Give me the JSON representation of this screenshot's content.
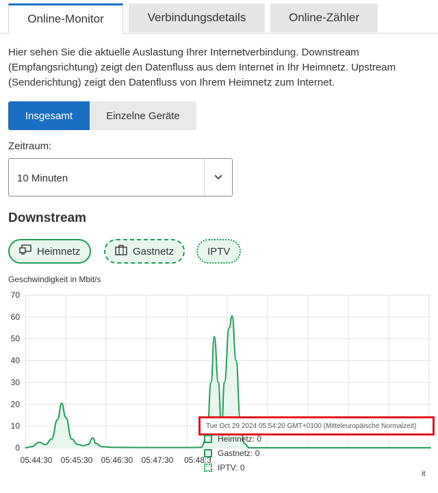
{
  "tabs": [
    {
      "label": "Online-Monitor",
      "active": true
    },
    {
      "label": "Verbindungsdetails",
      "active": false
    },
    {
      "label": "Online-Zähler",
      "active": false
    }
  ],
  "intro": "Hier sehen Sie die aktuelle Auslastung Ihrer Internetverbindung. Downstream (Empfangsrichtung) zeigt den Datenfluss aus dem Internet in Ihr Heimnetz. Upstream (Senderichtung) zeigt den Datenfluss von Ihrem Heimnetz zum Internet.",
  "segments": {
    "total": "Insgesamt",
    "devices": "Einzelne Geräte"
  },
  "period": {
    "label": "Zeitraum:",
    "value": "10 Minuten"
  },
  "section_title": "Downstream",
  "chips": [
    {
      "label": "Heimnetz",
      "icon": "monitor-icon"
    },
    {
      "label": "Gastnetz",
      "icon": "suitcase-icon"
    },
    {
      "label": "IPTV",
      "icon": ""
    }
  ],
  "colors": {
    "accent": "#1b6fc2",
    "series": "#1f9d55",
    "fill": "#e8f6ee",
    "highlight": "#e3141e"
  },
  "chart_data": {
    "type": "area",
    "ylabel": "Geschwindigkeit in Mbit/s",
    "ylim": [
      0,
      70
    ],
    "yticks": [
      0,
      10,
      20,
      30,
      40,
      50,
      60,
      70
    ],
    "xticks": [
      "05:44:30",
      "05:45:30",
      "05:46:30",
      "05:47:30",
      "05:48:3"
    ],
    "grid": true,
    "series": [
      {
        "name": "Heimnetz",
        "points": [
          [
            0,
            0
          ],
          [
            0.15,
            0.5
          ],
          [
            0.35,
            2.5
          ],
          [
            0.5,
            1.5
          ],
          [
            0.65,
            4
          ],
          [
            0.8,
            13
          ],
          [
            0.9,
            20.5
          ],
          [
            1.0,
            14
          ],
          [
            1.15,
            4
          ],
          [
            1.3,
            1.5
          ],
          [
            1.45,
            1
          ],
          [
            1.55,
            1.5
          ],
          [
            1.67,
            4.5
          ],
          [
            1.75,
            2
          ],
          [
            1.9,
            0.5
          ],
          [
            2.2,
            0.2
          ],
          [
            3.0,
            0.1
          ],
          [
            4.0,
            0.1
          ],
          [
            4.35,
            0.2
          ],
          [
            4.5,
            5
          ],
          [
            4.6,
            30
          ],
          [
            4.68,
            51
          ],
          [
            4.78,
            30
          ],
          [
            4.86,
            8
          ],
          [
            4.93,
            30
          ],
          [
            5.05,
            55
          ],
          [
            5.12,
            60.5
          ],
          [
            5.22,
            40
          ],
          [
            5.32,
            14
          ],
          [
            5.42,
            2
          ],
          [
            5.55,
            0
          ]
        ]
      }
    ],
    "tooltip": {
      "time": "Tue Oct 29 2024 05:54:20 GMT+0100 (Mitteleuropäische Normalzeit)",
      "rows": [
        {
          "label": "Heimnetz: 0",
          "style": "solid"
        },
        {
          "label": "Gastnetz: 0",
          "style": "dash"
        },
        {
          "label": "IPTV: 0",
          "style": "dot"
        }
      ]
    }
  },
  "edge_text": "it"
}
